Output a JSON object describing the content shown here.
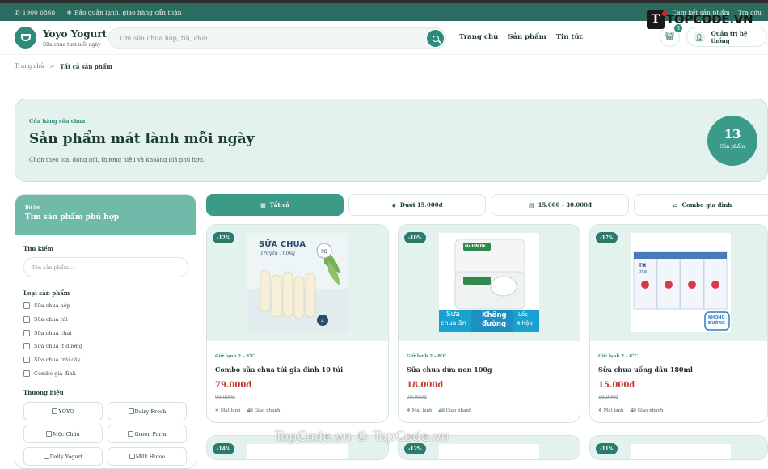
{
  "topbar": {
    "phone": "1900 6868",
    "notice": "Bảo quản lạnh, giao hàng cẩn thận",
    "right_1": "Cam kết sản phẩm",
    "right_2": "Tra cứu"
  },
  "header": {
    "brand": "Yoyo Yogurt",
    "brand_sub": "Sữa chua tươi mỗi ngày",
    "search_placeholder": "Tìm sữa chua hộp, túi, chai...",
    "nav": [
      "Trang chủ",
      "Sản phẩm",
      "Tin tức"
    ],
    "cart_count": "3",
    "account_label": "Quản trị hệ thống"
  },
  "watermark": {
    "logo_letter": "T",
    "logo_text": "TOPCODE.VN",
    "bottom_text": "TopCode.vn © TopCode.vn"
  },
  "breadcrumb": {
    "home": "Trang chủ",
    "separator": ">",
    "current": "Tất cả sản phẩm"
  },
  "hero": {
    "kicker": "Cửa hàng sữa chua",
    "title": "Sản phẩm mát lành mỗi ngày",
    "description": "Chọn theo loại đóng gói, thương hiệu và khoảng giá phù hợp.",
    "count": "13",
    "count_unit": "Sản phẩm"
  },
  "sidebar": {
    "kicker": "Bộ lọc",
    "title": "Tìm sản phẩm phù hợp",
    "search_label": "Tìm kiếm",
    "search_placeholder": "Tên sản phẩm...",
    "type_label": "Loại sản phẩm",
    "types": [
      "Sữa chua hộp",
      "Sữa chua túi",
      "Sữa chua chai",
      "Sữa chua ít đường",
      "Sữa chua trái cây",
      "Combo gia đình"
    ],
    "brand_label": "Thương hiệu",
    "brands": [
      "YOYO",
      "Dairy Fresh",
      "Mộc Châu",
      "Green Farm",
      "Daily Yogurt",
      "Milk Home"
    ]
  },
  "tabs": [
    {
      "label": "Tất cả",
      "icon": "grid-icon"
    },
    {
      "label": "Dưới 15.000đ",
      "icon": "tag-icon"
    },
    {
      "label": "15.000 - 30.000đ",
      "icon": "calendar-icon"
    },
    {
      "label": "Combo gia đình",
      "icon": "home-icon"
    }
  ],
  "products": [
    {
      "discount": "-12%",
      "cold": "Giữ lạnh 2 - 8°C",
      "name": "Combo sữa chua túi gia đình 10 túi",
      "price": "79.000đ",
      "old_price": "90.000đ",
      "tag_1": "Mát lạnh",
      "tag_2": "Giao nhanh"
    },
    {
      "discount": "-10%",
      "cold": "Giữ lạnh 2 - 8°C",
      "name": "Sữa chua dứa non 100g",
      "price": "18.000đ",
      "old_price": "20.000đ",
      "tag_1": "Mát lạnh",
      "tag_2": "Giao nhanh"
    },
    {
      "discount": "-17%",
      "cold": "Giữ lạnh 2 - 8°C",
      "name": "Sữa chua uống dâu 180ml",
      "price": "15.000đ",
      "old_price": "18.000đ",
      "tag_1": "Mát lạnh",
      "tag_2": "Giao nhanh"
    },
    {
      "discount": "-14%"
    },
    {
      "discount": "-12%"
    },
    {
      "discount": "-11%"
    }
  ],
  "product_images": {
    "p1_title": "SỮA CHUA",
    "p1_sub": "Truyền Thống",
    "p2_brand": "NutiMilk",
    "p2_l1": "Sữa",
    "p2_l2": "chua ăn",
    "p2_m1": "Không",
    "p2_m2": "đường",
    "p2_r1": "Lốc",
    "p2_r2": "4 hộp",
    "p3_brand": "TH",
    "p3_sub": "true",
    "p3_badge_1": "KHÔNG",
    "p3_badge_2": "ĐƯỜNG"
  },
  "colors": {
    "primary": "#2f8a7b",
    "topbar": "#2b6b60",
    "hero_bg": "#e4f2ee",
    "price": "#c53a2f"
  }
}
